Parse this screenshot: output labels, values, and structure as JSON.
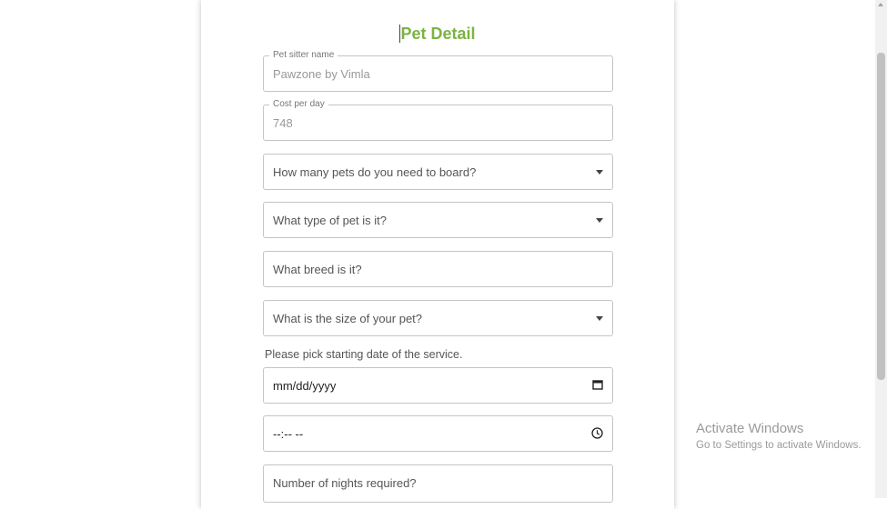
{
  "form": {
    "title": "Pet Detail",
    "pet_sitter_name": {
      "label": "Pet sitter name",
      "value": "Pawzone by Vimla"
    },
    "cost_per_day": {
      "label": "Cost per day",
      "value": "748"
    },
    "pets_count": {
      "placeholder": "How many pets do you need to board?",
      "icon": "chevron-down-icon"
    },
    "pet_type": {
      "placeholder": "What type of pet is it?",
      "icon": "chevron-down-icon"
    },
    "breed": {
      "placeholder": "What breed is it?"
    },
    "pet_size": {
      "placeholder": "What is the size of your pet?",
      "icon": "chevron-down-icon"
    },
    "start_date_help": "Please pick starting date of the service.",
    "start_date": {
      "value": "mm/dd/yyyy",
      "icon": "calendar-icon"
    },
    "start_time": {
      "value": "--:-- --",
      "icon": "clock-icon"
    },
    "nights": {
      "placeholder": "Number of nights required?"
    }
  },
  "overlay": {
    "activate_title": "Activate Windows",
    "activate_subtitle": "Go to Settings to activate Windows."
  },
  "colors": {
    "title_green": "#7cb342",
    "border": "#c4c4c4"
  }
}
